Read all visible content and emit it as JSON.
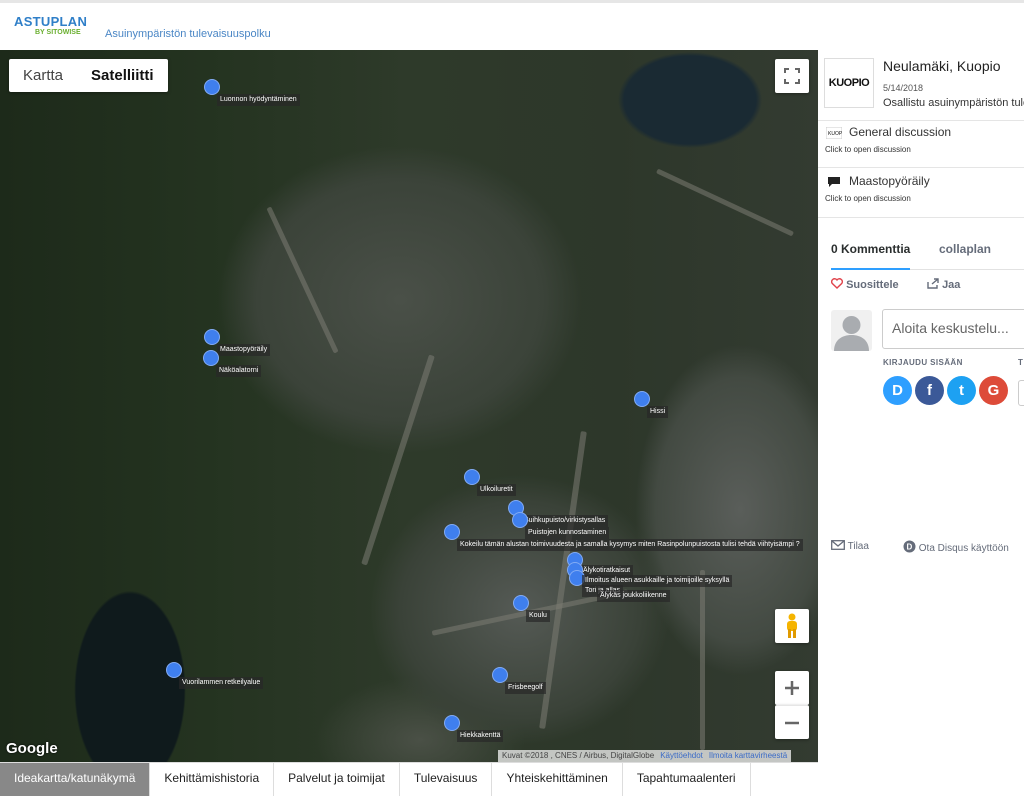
{
  "header": {
    "logo_main": "ASTUPLAN",
    "logo_sub": "BY SITOWISE",
    "tagline": "Asuinympäristön tulevaisuuspolku"
  },
  "map": {
    "map_type_options": [
      "Kartta",
      "Satelliitti"
    ],
    "selected_map_type": "Satelliitti",
    "google_logo": "Google",
    "attribution": "Kuvat ©2018 , CNES / Airbus, DigitalGlobe",
    "terms_link": "Käyttöehdot",
    "report_link": "Ilmoita karttavirheestä",
    "markers": [
      {
        "label": "Luonnon hyödyntäminen"
      },
      {
        "label": "Maastopyöräily"
      },
      {
        "label": "Näköalatorni"
      },
      {
        "label": "Hissi"
      },
      {
        "label": "Ulkoiluretit"
      },
      {
        "label": "Suihkupuisto/virkistysallas"
      },
      {
        "label": "Puistojen kunnostaminen"
      },
      {
        "label": "Kokeilu tämän alustan toimivuudesta ja samalla kysymys miten Rasinpolunpuistosta tulisi tehdä viihtyisämpi ?"
      },
      {
        "label": "Älykotiratkaisut"
      },
      {
        "label": "Liikennejärjestelyjen ongelmat"
      },
      {
        "label": "Tori ja allas"
      },
      {
        "label": "Älykäs joukkoliikenne"
      },
      {
        "label": "Koulu"
      },
      {
        "label": "Vuorilammen retkeilyalue"
      },
      {
        "label": "Frisbeegolf"
      },
      {
        "label": "Hiekkakenttä"
      },
      {
        "label": "Ilmoitus alueen asukkaille ja toimijoille syksyllä"
      }
    ]
  },
  "sidebar": {
    "logo_text": "KUOPIO",
    "title": "Neulamäki, Kuopio",
    "date": "5/14/2018",
    "description": "Osallistu asuinympäristön tulevaisuuteen",
    "discussions": [
      {
        "title": "General discussion",
        "subtitle": "Click to open discussion"
      },
      {
        "title": "Maastopyöräily",
        "subtitle": "Click to open discussion"
      }
    ],
    "tab_comments": "0 Kommenttia",
    "tab_site": "collaplan",
    "recommend": "Suosittele",
    "share": "Jaa",
    "comment_placeholder": "Aloita keskustelu...",
    "login_label": "KIRJAUDU SISÄÄN",
    "login_label_cut": "T",
    "social": [
      {
        "letter": "D",
        "color": "#2e9fff"
      },
      {
        "letter": "f",
        "color": "#3b5998"
      },
      {
        "letter": "t",
        "color": "#1da1f2"
      },
      {
        "letter": "G",
        "color": "#dd4b39"
      }
    ],
    "subscribe": "Tilaa",
    "disqus_note": "Ota Disqus käyttöön"
  },
  "bottom_tabs": [
    "Ideakartta/katunäkymä",
    "Kehittämishistoria",
    "Palvelut ja toimijat",
    "Tulevaisuus",
    "Yhteiskehittäminen",
    "Tapahtumaalenteri"
  ],
  "active_bottom_tab": "Ideakartta/katunäkymä",
  "colors": {
    "brand_blue": "#2f7fc8",
    "brand_green": "#6aaf2f",
    "marker_blue": "#3f7fee",
    "disqus_tab_underline": "#2e9fff"
  }
}
